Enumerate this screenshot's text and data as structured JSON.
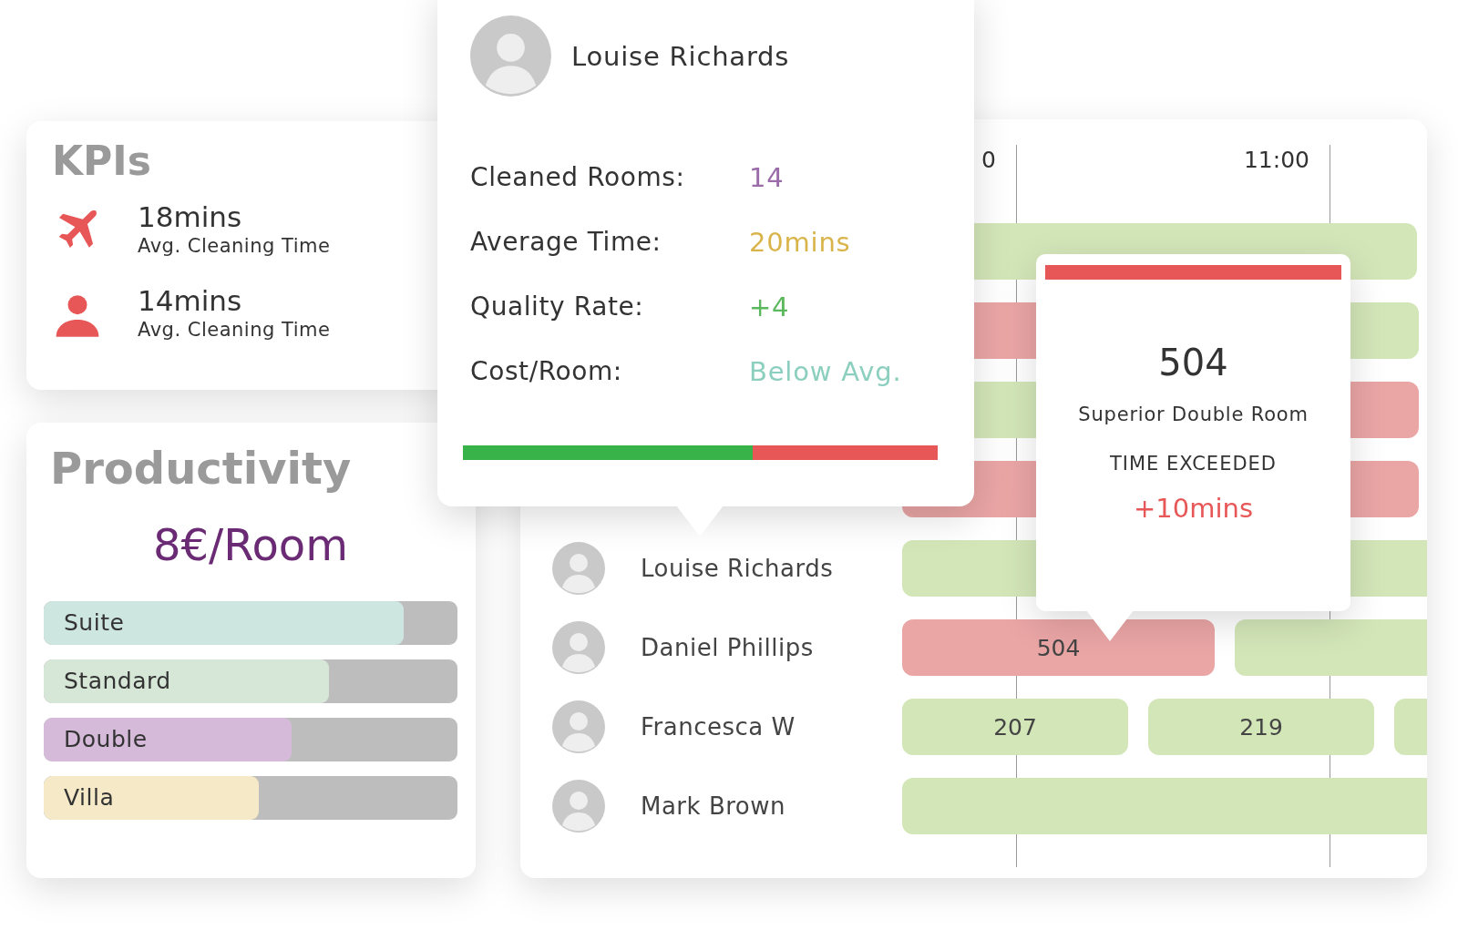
{
  "kpis": {
    "title": "KPIs",
    "items": [
      {
        "value": "18mins",
        "label": "Avg. Cleaning Time"
      },
      {
        "value": "14mins",
        "label": "Avg. Cleaning Time"
      }
    ]
  },
  "productivity": {
    "title": "Productivity",
    "rate": "8€/Room",
    "categories": [
      {
        "label": "Suite",
        "level": 0.87,
        "color": "#cde6df"
      },
      {
        "label": "Standard",
        "level": 0.69,
        "color": "#d6e7d8"
      },
      {
        "label": "Double",
        "level": 0.6,
        "color": "#d5bad9"
      },
      {
        "label": "Villa",
        "level": 0.52,
        "color": "#f5e9c8"
      }
    ]
  },
  "schedule": {
    "times": [
      "0",
      "11:00"
    ],
    "rows": [
      {
        "bars": [
          {
            "late": false
          }
        ]
      },
      {
        "bars": [
          {
            "late": true
          },
          {
            "late": false
          }
        ]
      },
      {
        "bars": [
          {
            "late": false
          },
          {
            "late": true
          }
        ]
      },
      {
        "bars": [
          {
            "late": true
          },
          {
            "late": true
          }
        ]
      },
      {
        "name": "Louise Richards",
        "bars": [
          {
            "late": false
          },
          {
            "late": false
          }
        ]
      },
      {
        "name": "Daniel Phillips",
        "bars": [
          {
            "late": true,
            "label": "504"
          },
          {
            "late": false
          }
        ]
      },
      {
        "name": "Francesca W",
        "bars": [
          {
            "late": false,
            "label": "207"
          },
          {
            "late": false,
            "label": "219"
          },
          {
            "late": false
          }
        ]
      },
      {
        "name": "Mark Brown",
        "bars": [
          {
            "late": false
          }
        ]
      }
    ]
  },
  "staff_popup": {
    "name": "Louise Richards",
    "stats": [
      {
        "label": "Cleaned Rooms:",
        "value": "14",
        "color": "#9b6aa8"
      },
      {
        "label": "Average Time:",
        "value": "20mins",
        "color": "#d9b44a"
      },
      {
        "label": "Quality Rate:",
        "value": "+4",
        "color": "#5cb85c"
      },
      {
        "label": "Cost/Room:",
        "value": "Below Avg.",
        "color": "#8ccfbf"
      }
    ],
    "level": 0.61
  },
  "room_popup": {
    "room": "504",
    "type": "Superior Double Room",
    "status": "TIME EXCEEDED",
    "delta": "+10mins"
  }
}
